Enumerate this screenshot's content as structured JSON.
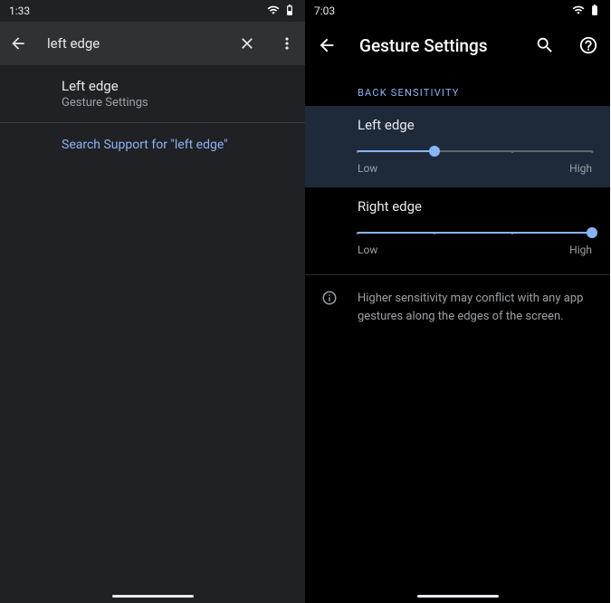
{
  "left": {
    "status_time": "1:33",
    "search_query": "left edge",
    "result": {
      "title": "Left edge",
      "subtitle": "Gesture Settings"
    },
    "support_text": "Search Support for \"left edge\""
  },
  "right": {
    "status_time": "7:03",
    "title": "Gesture Settings",
    "section": "BACK SENSITIVITY",
    "sliders": {
      "left_edge": {
        "label": "Left edge",
        "low": "Low",
        "high": "High",
        "percent": 33
      },
      "right_edge": {
        "label": "Right edge",
        "low": "Low",
        "high": "High",
        "percent": 100
      }
    },
    "info": "Higher sensitivity may conflict with any app gestures along the edges of the screen."
  }
}
